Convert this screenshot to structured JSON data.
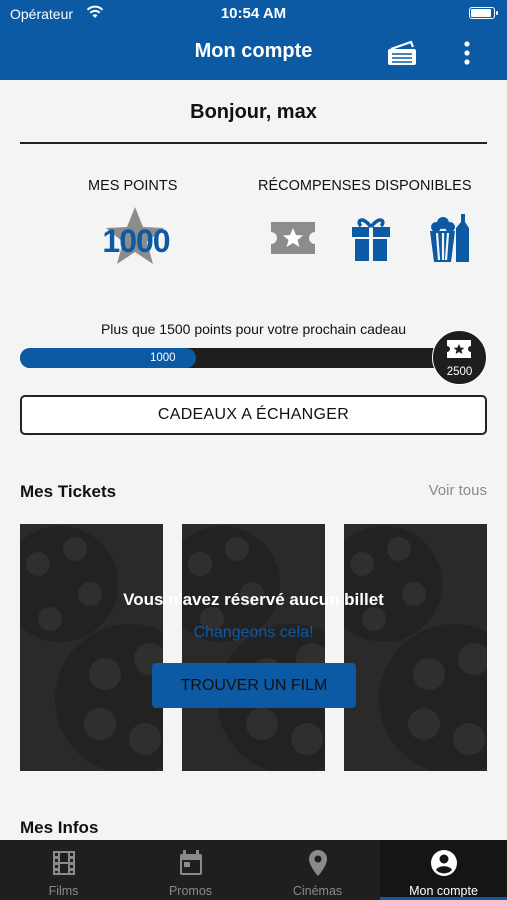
{
  "status_bar": {
    "carrier": "Opérateur",
    "time": "10:54 AM"
  },
  "header": {
    "title": "Mon compte"
  },
  "greeting": "Bonjour, max",
  "points": {
    "label": "MES POINTS",
    "value": "1000"
  },
  "rewards": {
    "label": "RÉCOMPENSES DISPONIBLES",
    "items": [
      "ticket-icon",
      "gift-icon",
      "popcorn-drink-icon"
    ]
  },
  "progress": {
    "caption": "Plus que 1500 points pour votre prochain cadeau",
    "current_label": "1000",
    "goal_label": "2500",
    "current": 1000,
    "goal": 2500
  },
  "exchange_button": "CADEAUX A ÉCHANGER",
  "tickets": {
    "title": "Mes Tickets",
    "see_all": "Voir tous",
    "empty_title": "Vous n'avez réservé aucun billet",
    "empty_subtitle": "Changeons cela!",
    "find_button": "TROUVER UN FILM"
  },
  "infos": {
    "title": "Mes Infos"
  },
  "tabs": [
    {
      "label": "Films",
      "icon": "film-icon"
    },
    {
      "label": "Promos",
      "icon": "calendar-icon"
    },
    {
      "label": "Cinémas",
      "icon": "location-pin-icon"
    },
    {
      "label": "Mon compte",
      "icon": "account-icon",
      "active": true
    }
  ],
  "colors": {
    "brand": "#0b5aa3",
    "dark": "#1e1e1e",
    "muted": "#8a8a8a"
  }
}
